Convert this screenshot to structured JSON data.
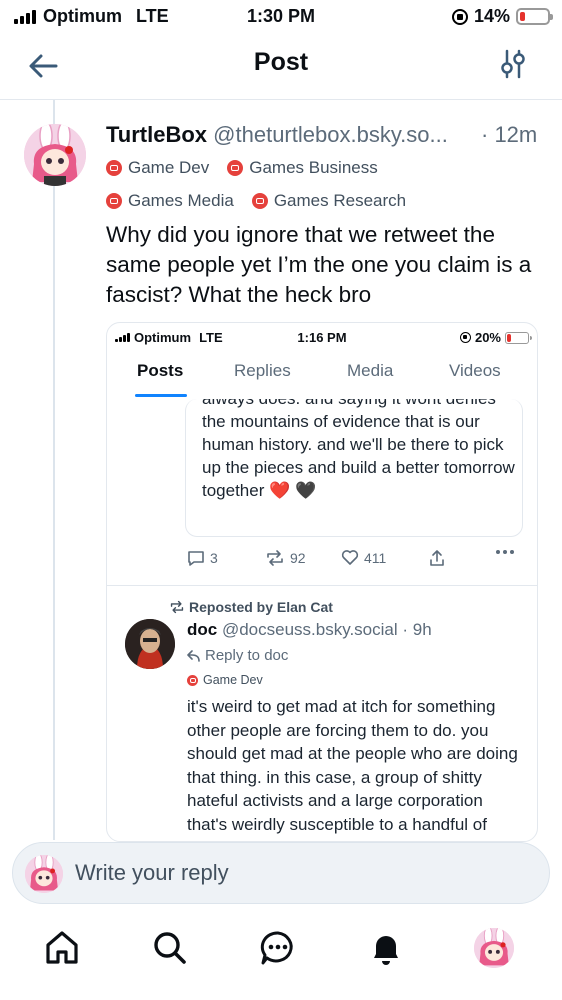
{
  "status_bar": {
    "carrier": "Optimum",
    "network": "LTE",
    "time": "1:30 PM",
    "battery": "14%"
  },
  "header": {
    "title": "Post"
  },
  "post": {
    "author_name": "TurtleBox",
    "author_handle": "@theturtlebox.bsky.so...",
    "time": "· 12m",
    "labels": [
      "Game Dev",
      "Games Business",
      "Games Media",
      "Games Research"
    ],
    "text": "Why did you ignore that we retweet the same people yet I’m the one you claim is a fascist? What the heck bro"
  },
  "screenshot": {
    "status_bar": {
      "carrier": "Optimum",
      "network": "LTE",
      "time": "1:16 PM",
      "battery": "20%"
    },
    "tabs": [
      "Posts",
      "Replies",
      "Media",
      "Videos"
    ],
    "active_tab": "Posts",
    "quote_text": "always does. and saying it wont denies the mountains of evidence that is our human history. and we'll be there to pick up the pieces and build a better tomorrow together",
    "quote_emoji_red": "❤️",
    "quote_emoji_black": "🖤",
    "actions": {
      "replies": "3",
      "reposts": "92",
      "likes": "411"
    },
    "repost_label": "Reposted by Elan Cat",
    "reply_post": {
      "author_name": "doc",
      "author_handle": "@docseuss.bsky.social",
      "time": "· 9h",
      "reply_to": "Reply to doc",
      "label": "Game Dev",
      "text": "it's weird to get mad at itch for something other people are forcing them to do. you should get mad at the people who are doing that thing. in this case, a group of shitty hateful activists and a large corporation that's weirdly susceptible to a handful of phone callers"
    }
  },
  "reply_bar": {
    "placeholder": "Write your reply"
  },
  "colors": {
    "accent": "#1083fe",
    "label_red": "#e5413c",
    "battery_low": "#e5322d"
  },
  "icons": [
    "back-arrow-icon",
    "filter-icon",
    "home-icon",
    "search-icon",
    "chat-icon",
    "bell-icon"
  ]
}
